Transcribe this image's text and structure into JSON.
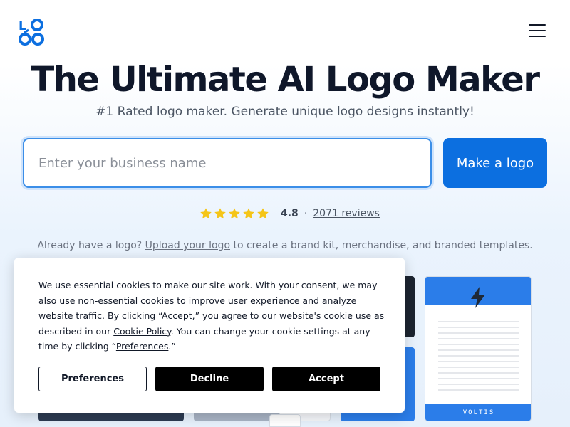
{
  "brand": {
    "logo_text": "LOGO",
    "accent_color": "#0c6fe0"
  },
  "header": {
    "menu_icon": "hamburger-menu-icon"
  },
  "hero": {
    "title": "The Ultimate AI Logo Maker",
    "subtitle": "#1 Rated logo maker. Generate unique logo designs instantly!",
    "input_placeholder": "Enter your business name",
    "cta_label": "Make a logo"
  },
  "rating": {
    "stars": 5,
    "star_color": "#f5c518",
    "value": "4.8",
    "separator": "·",
    "reviews_label": "2071 reviews"
  },
  "upload_line": {
    "prefix": "Already have a logo?",
    "link": "Upload your logo",
    "suffix": "to create a brand kit, merchandise, and branded templates."
  },
  "gallery": {
    "letterhead_name": "VOLTIS"
  },
  "cookie": {
    "text_1": "We use essential cookies to make our site work. With your consent, we may also use non-essential cookies to improve user experience and analyze website traffic. By clicking “Accept,” you agree to our website's cookie use as described in our",
    "policy_link": "Cookie Policy",
    "text_2": ". You can change your cookie settings at any time by clicking “",
    "pref_link": "Preferences",
    "text_3": ".”",
    "preferences_label": "Preferences",
    "decline_label": "Decline",
    "accept_label": "Accept"
  }
}
